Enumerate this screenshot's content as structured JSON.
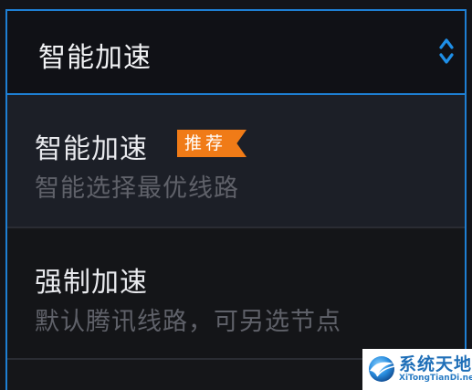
{
  "select": {
    "value": "智能加速"
  },
  "options": [
    {
      "title": "智能加速",
      "badge": "推荐",
      "description": "智能选择最优线路"
    },
    {
      "title": "强制加速",
      "description": "默认腾讯线路，可另选节点"
    }
  ],
  "icons": {
    "select_arrows": "chevron-up-down-icon",
    "watermark_logo": "globe-bird-logo"
  },
  "watermark": {
    "name_cn": "系统天地",
    "url": "XiTongTianDi.net"
  },
  "colors": {
    "accent": "#1e7fd3",
    "badge": "#f07b17",
    "background": "#131419",
    "selected_option": "#1c1f27"
  }
}
